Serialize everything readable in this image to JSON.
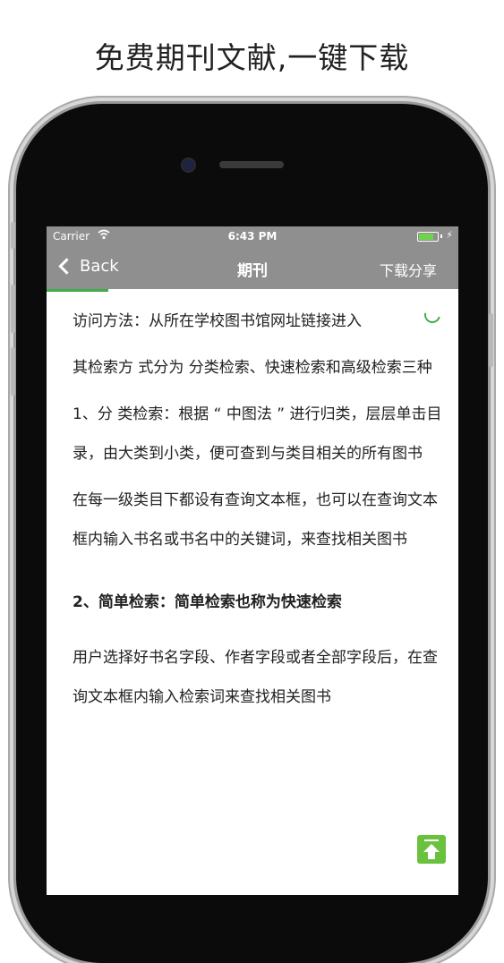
{
  "headline": "免费期刊文献,一键下载",
  "status_bar": {
    "carrier": "Carrier",
    "time": "6:43 PM",
    "battery_level": 0.9,
    "icons": [
      "wifi-icon",
      "battery-icon",
      "charging-bolt-icon"
    ]
  },
  "nav": {
    "back_label": "Back",
    "title": "期刊",
    "action_label": "下载分享"
  },
  "page_load_progress": 0.15,
  "content": {
    "p1": "访问方法：从所在学校图书馆网址链接进入",
    "p2": "其检索方 式分为 分类检索、快速检索和高级检索三种",
    "p3": "1、分 类检索：根据 “ 中图法 ” 进行归类，层层单击目录，由大类到小类，便可查到与类目相关的所有图书",
    "p4": "在每一级类目下都设有查询文本框，也可以在查询文本框内输入书名或书名中的关键词，来查找相关图书",
    "p5": "2、简单检索：简单检索也称为快速检索",
    "p6": "用户选择好书名字段、作者字段或者全部字段后，在查询文本框内输入检索词来查找相关图书"
  },
  "colors": {
    "nav_bg": "#8f8f8f",
    "accent_green": "#3fae4a",
    "scroll_button": "#6ac13e"
  }
}
